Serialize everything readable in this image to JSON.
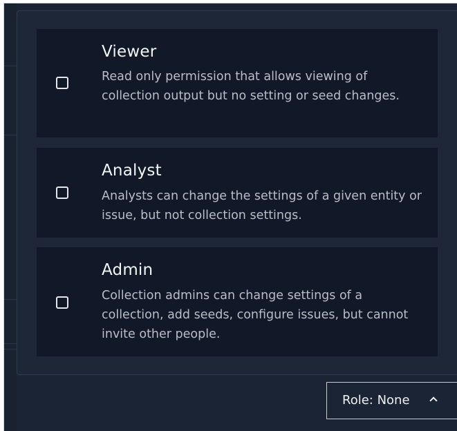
{
  "roles": [
    {
      "title": "Viewer",
      "description": "Read only permission that allows viewing of collection output but no setting or seed changes.",
      "checked": false
    },
    {
      "title": "Analyst",
      "description": "Analysts can change the settings of a given entity or issue, but not collection settings.",
      "checked": false
    },
    {
      "title": "Admin",
      "description": "Collection admins can change settings of a collection, add seeds, configure issues, but cannot invite other people.",
      "checked": false
    }
  ],
  "role_button": {
    "label": "Role: None",
    "icon": "chevron-up-icon"
  },
  "colors": {
    "page_bg": "#1b2434",
    "popover_bg": "#1e2738",
    "option_bg": "#111827",
    "title_text": "#f3f4f6",
    "desc_text": "#b9bec8",
    "button_border": "#c8cdd5"
  }
}
